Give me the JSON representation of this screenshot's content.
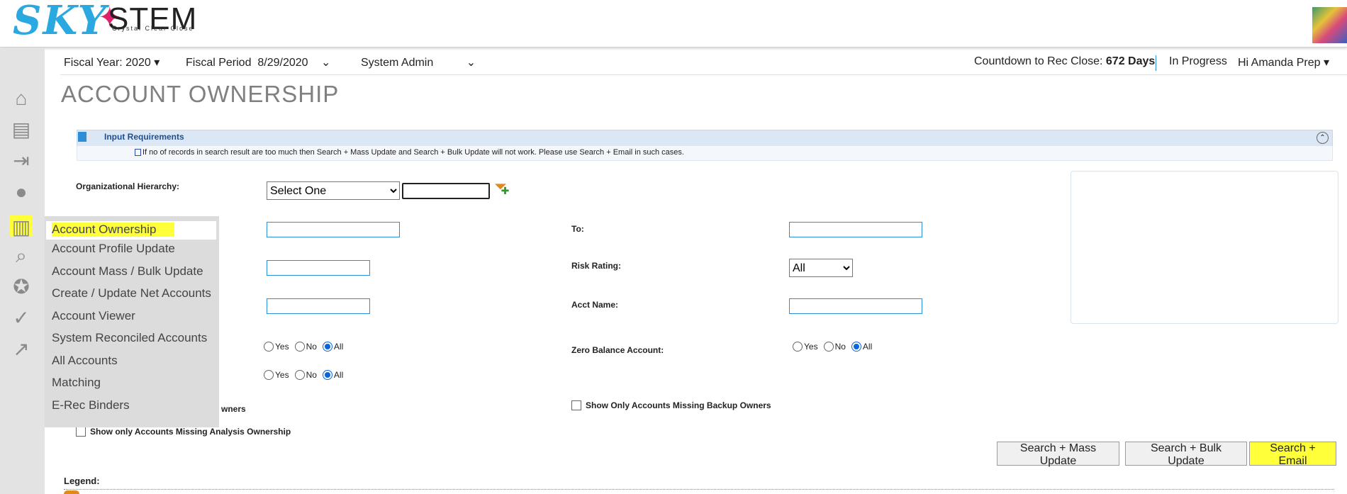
{
  "logo": {
    "brand_left": "SKY",
    "brand_right": "STEM",
    "tagline": "Crystal Clear Close"
  },
  "header": {
    "fiscal_year": "Fiscal Year: 2020",
    "fiscal_period": "Fiscal Period  8/29/2020",
    "role": "System Admin",
    "countdown_label": "Countdown to Rec Close:",
    "countdown_value": "672 Days",
    "status": "In Progress",
    "greeting": "Hi Amanda Prep"
  },
  "page": {
    "title": "ACCOUNT OWNERSHIP"
  },
  "info": {
    "title": "Input Requirements",
    "text": "If no of records in search result are too much then Search + Mass Update and Search + Bulk Update will not work. Please use Search + Email in such cases."
  },
  "form": {
    "org_label": "Organizational Hierarchy:",
    "org_select": "Select One",
    "to_label": "To:",
    "risk_label": "Risk Rating:",
    "risk_value": "All",
    "acct_name_label": "Acct Name:",
    "zero_balance_label": "Zero Balance Account:",
    "radio_yes": "Yes",
    "radio_no": "No",
    "radio_all": "All",
    "missing_owners_partial": "wners",
    "missing_backup_owners": "Show Only Accounts Missing Backup Owners",
    "missing_analysis": "Show only Accounts Missing Analysis Ownership"
  },
  "menu": {
    "items": [
      "Account Ownership",
      "Account Profile Update",
      "Account Mass / Bulk Update",
      "Create / Update Net Accounts",
      "Account Viewer",
      "System Reconciled Accounts",
      "All Accounts",
      "Matching",
      "E-Rec Binders"
    ]
  },
  "buttons": {
    "mass_update": "Search + Mass Update",
    "bulk_update": "Search + Bulk Update",
    "email": "Search + Email"
  },
  "legend": {
    "label": "Legend:"
  },
  "icons": {
    "sidebar": [
      "home-icon",
      "dashboard-icon",
      "import-icon",
      "user-icon",
      "accounts-icon",
      "search-report-icon",
      "certification-icon",
      "reconciliation-icon",
      "analytics-icon"
    ]
  },
  "colors": {
    "highlight": "#ffff3a",
    "brand_blue": "#2aa8e0",
    "input_border": "#2b8ed8"
  }
}
